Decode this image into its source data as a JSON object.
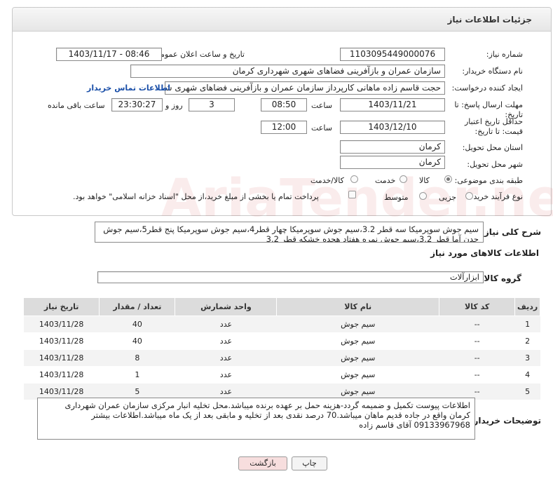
{
  "header": {
    "title": "جزئیات اطلاعات نیاز"
  },
  "form": {
    "need_number_label": "شماره نیاز:",
    "need_number": "1103095449000076",
    "announce_label": "تاریخ و ساعت اعلان عمومی:",
    "announce_value": "1403/11/17 - 08:46",
    "buyer_label": "نام دستگاه خریدار:",
    "buyer_value": "سازمان عمران و بازآفرینی فضاهای شهری شهرداری کرمان",
    "creator_label": "ایجاد کننده درخواست:",
    "creator_value": "حجت قاسم زاده ماهانی کارپرداز سازمان عمران و بازآفرینی فضاهای شهری شهر",
    "contact_link": "اطلاعات تماس خریدار",
    "reply_deadline_label": "مهلت ارسال پاسخ: تا تاریخ:",
    "reply_date": "1403/11/21",
    "time_label": "ساعت",
    "reply_time": "08:50",
    "days_value": "3",
    "days_label": "روز و",
    "remaining_time": "23:30:27",
    "remaining_label": "ساعت باقی مانده",
    "price_deadline_label": "حداقل تاریخ اعتبار قیمت: تا تاریخ:",
    "price_date": "1403/12/10",
    "price_time": "12:00",
    "province_label": "استان محل تحویل:",
    "province_value": "کرمان",
    "city_label": "شهر محل تحویل:",
    "city_value": "کرمان",
    "category_label": "طبقه بندی موضوعی:",
    "category_options": [
      "کالا",
      "خدمت",
      "کالا/خدمت"
    ],
    "category_selected": "کالا",
    "process_label": "نوع فرآیند خرید :",
    "process_options": [
      "جزیی",
      "متوسط"
    ],
    "process_note": "پرداخت تمام یا بخشی از مبلغ خرید،از محل \"اسناد خزانه اسلامی\" خواهد بود."
  },
  "description": {
    "label": "شرح کلی نیاز:",
    "text": "سیم جوش سوپرمیکا سه قطر 3.2،سیم جوش سوپرمیکا چهار قطر4،سیم جوش سوپرمیکا پنج قطر5،سیم جوش چدن آما قطر 3.2،سیم جوش نمره هفتاد هجده خشکه قطر 3.2"
  },
  "goods": {
    "section_title": "اطلاعات کالاهای مورد نیاز",
    "group_label": "گروه کالا:",
    "group_value": "ابزارآلات",
    "columns": [
      "ردیف",
      "کد کالا",
      "نام کالا",
      "واحد شمارش",
      "تعداد / مقدار",
      "تاریخ نیاز"
    ],
    "rows": [
      {
        "idx": "1",
        "code": "--",
        "name": "سیم جوش",
        "unit": "عدد",
        "qty": "40",
        "date": "1403/11/28"
      },
      {
        "idx": "2",
        "code": "--",
        "name": "سیم جوش",
        "unit": "عدد",
        "qty": "40",
        "date": "1403/11/28"
      },
      {
        "idx": "3",
        "code": "--",
        "name": "سیم جوش",
        "unit": "عدد",
        "qty": "8",
        "date": "1403/11/28"
      },
      {
        "idx": "4",
        "code": "--",
        "name": "سیم جوش",
        "unit": "عدد",
        "qty": "1",
        "date": "1403/11/28"
      },
      {
        "idx": "5",
        "code": "--",
        "name": "سیم جوش",
        "unit": "عدد",
        "qty": "5",
        "date": "1403/11/28"
      }
    ]
  },
  "buyer_notes": {
    "label": "توضیحات خریدار:",
    "text": "اطلاعات پیوست تکمیل و ضمیمه گردد-هزینه حمل بر عهده برنده میباشد.محل تخلیه انبار مرکزی سازمان عمران شهرداری کرمان واقع در جاده قدیم ماهان میباشد.70 درصد نقدی بعد از تخلیه و مابقی بعد از یک ماه میباشد.اطلاعات بیشتر 09133967968 آقای قاسم زاده"
  },
  "buttons": {
    "print": "چاپ",
    "back": "بازگشت"
  },
  "watermark": "AriaTender.neT",
  "colors": {
    "link": "#1a4fa8",
    "back_button": "#f7dede",
    "print_button": "#f4f4f4"
  }
}
